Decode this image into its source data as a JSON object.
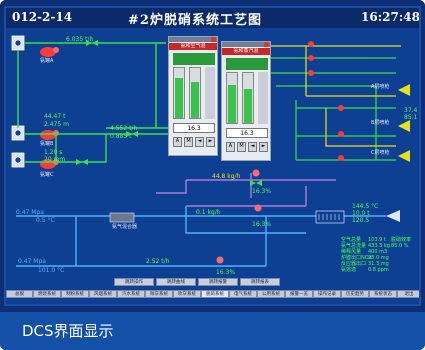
{
  "window": {
    "date": "012-2-14",
    "title": "#2炉脱硝系统工艺图",
    "time": "16:27:48"
  },
  "caption": "DCS界面显示",
  "colors": {
    "background": "#0d3f93",
    "pipe_green": "#39e04a",
    "pipe_yellow": "#e7e11d",
    "pipe_blue": "#4db3ff",
    "pipe_purple": "#b07adf",
    "text_green": "#42ff5a",
    "valve_red": "#ff3a3a"
  },
  "faceplates": [
    {
      "title": "氨和空气混",
      "value": "16.3",
      "buttons": [
        "A",
        "M",
        "◄",
        "►"
      ]
    },
    {
      "title": "氨和蒸汽混",
      "value": "16.3",
      "buttons": [
        "A",
        "M",
        "◄",
        "►"
      ]
    }
  ],
  "process_values": {
    "top_flow": "6.035 t/h",
    "left_a1": "44.47 t",
    "left_a2": "2.475 m",
    "left_b1": "1.20 s",
    "left_b2": "20 mm",
    "mid_flow1": "4.552 t/h",
    "mid_flow2": "0.885 t",
    "purple_flow": "44.8 kg/h",
    "valve_pct1": "16.3%",
    "valve_pct2": "16.3%",
    "valve_pct3": "16.3%",
    "blue_left1": "0.47 Mpa",
    "blue_left2": "0.5 °C",
    "blue_mid": "0.1 kg/h",
    "bottom_left1": "0.47 Mpa",
    "bottom_left2": "101.0 °C",
    "bottom_flow": "2.52 t/h",
    "right_top1": "37.4",
    "right_top2": "85.1",
    "right_out1": "144.5 °C",
    "right_out2": "10.0 t",
    "right_out3": "120.5"
  },
  "labels": {
    "tank1": "氨罐A",
    "tank2": "氨罐B",
    "tank3": "氨罐C",
    "air_fan": "稀释风机",
    "mixer": "氨气混合器",
    "spray": "喷枪",
    "rack1": "A层喷枪",
    "rack2": "B层喷枪",
    "rack3": "C层喷枪"
  },
  "summary_rows": [
    {
      "label": "空气总量",
      "value": "103.9 t"
    },
    {
      "label": "氨气总流量",
      "value": "433.3 kg"
    },
    {
      "label": "稀释风量",
      "value": "400 m3"
    },
    {
      "label": "炉膛出口NOx",
      "value": "28.0 mg"
    },
    {
      "label": "反应器出口",
      "value": "31.3 mg"
    },
    {
      "label": "氨逃逸",
      "value": "0.8 ppm"
    },
    {
      "label": "脱硝效率",
      "value": "85.0 %"
    }
  ],
  "nav_buttons": [
    "跳转操作",
    "跳转曲线",
    "跳转报警",
    "跳转报表"
  ],
  "tabs": [
    "总貌",
    "燃烧系统",
    "制粉系统",
    "风烟系统",
    "汽水系统",
    "除灰系统",
    "吹灰系统",
    "脱硝系统",
    "电气系统",
    "公用系统",
    "报警一览",
    "操作记录",
    "历史趋势",
    "系统状态",
    "退出"
  ],
  "active_tab": 7
}
